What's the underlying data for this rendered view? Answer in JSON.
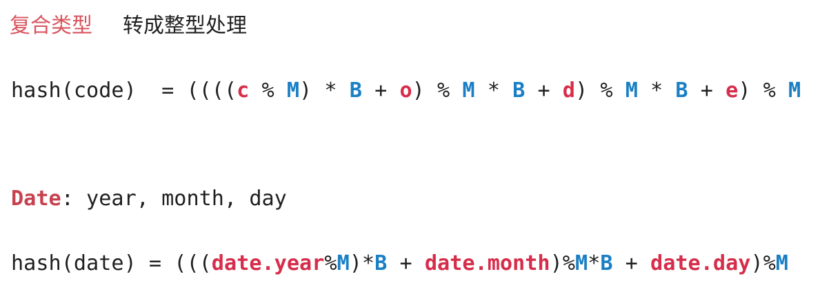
{
  "heading": {
    "title": "复合类型",
    "subtitle": "转成整型处理"
  },
  "colors": {
    "title": "#d9535c",
    "red_token": "#d62d4a",
    "blue_token": "#1a7fc4",
    "text": "#1f1f1f"
  },
  "formula_code": {
    "segments": [
      {
        "t": "hash(code)  = ((((",
        "c": "plain"
      },
      {
        "t": "c",
        "c": "red"
      },
      {
        "t": " % ",
        "c": "plain"
      },
      {
        "t": "M",
        "c": "blue"
      },
      {
        "t": ") * ",
        "c": "plain"
      },
      {
        "t": "B",
        "c": "blue"
      },
      {
        "t": " + ",
        "c": "plain"
      },
      {
        "t": "o",
        "c": "red"
      },
      {
        "t": ") % ",
        "c": "plain"
      },
      {
        "t": "M",
        "c": "blue"
      },
      {
        "t": " * ",
        "c": "plain"
      },
      {
        "t": "B",
        "c": "blue"
      },
      {
        "t": " + ",
        "c": "plain"
      },
      {
        "t": "d",
        "c": "red"
      },
      {
        "t": ") % ",
        "c": "plain"
      },
      {
        "t": "M",
        "c": "blue"
      },
      {
        "t": " * ",
        "c": "plain"
      },
      {
        "t": "B",
        "c": "blue"
      },
      {
        "t": " + ",
        "c": "plain"
      },
      {
        "t": "e",
        "c": "red"
      },
      {
        "t": ") % ",
        "c": "plain"
      },
      {
        "t": "M",
        "c": "blue"
      }
    ]
  },
  "date_fields": {
    "segments": [
      {
        "t": "Date",
        "c": "key"
      },
      {
        "t": ": year, month, day",
        "c": "plain"
      }
    ]
  },
  "formula_date": {
    "segments": [
      {
        "t": "hash(date) = (((",
        "c": "plain"
      },
      {
        "t": "date.year",
        "c": "red"
      },
      {
        "t": "%",
        "c": "plain"
      },
      {
        "t": "M",
        "c": "blue"
      },
      {
        "t": ")*",
        "c": "plain"
      },
      {
        "t": "B",
        "c": "blue"
      },
      {
        "t": " + ",
        "c": "plain"
      },
      {
        "t": "date.month",
        "c": "red"
      },
      {
        "t": ")%",
        "c": "plain"
      },
      {
        "t": "M",
        "c": "blue"
      },
      {
        "t": "*",
        "c": "plain"
      },
      {
        "t": "B",
        "c": "blue"
      },
      {
        "t": " + ",
        "c": "plain"
      },
      {
        "t": "date.day",
        "c": "red"
      },
      {
        "t": ")%",
        "c": "plain"
      },
      {
        "t": "M",
        "c": "blue"
      }
    ]
  }
}
